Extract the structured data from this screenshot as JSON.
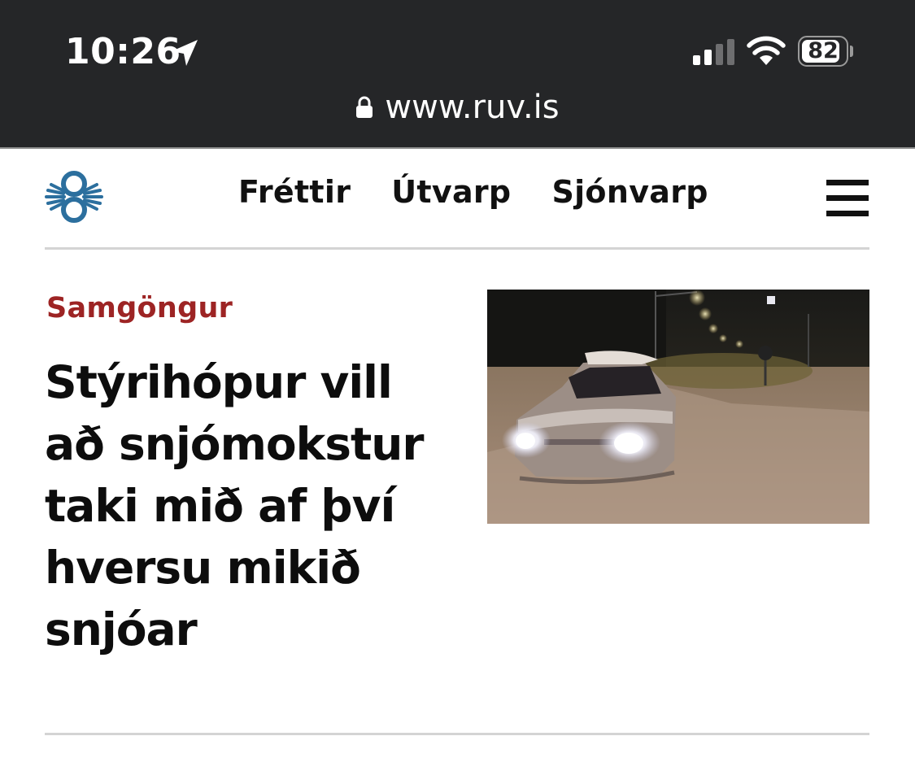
{
  "status_bar": {
    "time": "10:26",
    "battery_percent": "82",
    "battery_level": 0.82,
    "signal_bars_active": 2,
    "signal_bars_total": 4
  },
  "browser": {
    "url": "www.ruv.is"
  },
  "site_header": {
    "logo_icon": "ruv-logo-icon",
    "nav": [
      {
        "label": "Fréttir"
      },
      {
        "label": "Útvarp"
      },
      {
        "label": "Sjónvarp"
      }
    ],
    "menu_icon": "hamburger-menu-icon"
  },
  "article": {
    "category": "Samgöngur",
    "headline": "Stýrihópur vill að snjómokstur taki mið af því hversu mikið snjóar",
    "image_description_icon": "snowy-road-car-photo"
  },
  "colors": {
    "topbar_bg": "#252628",
    "category_red": "#9d2424",
    "logo_blue": "#2c6f9e",
    "divider": "#d4d4d4"
  }
}
